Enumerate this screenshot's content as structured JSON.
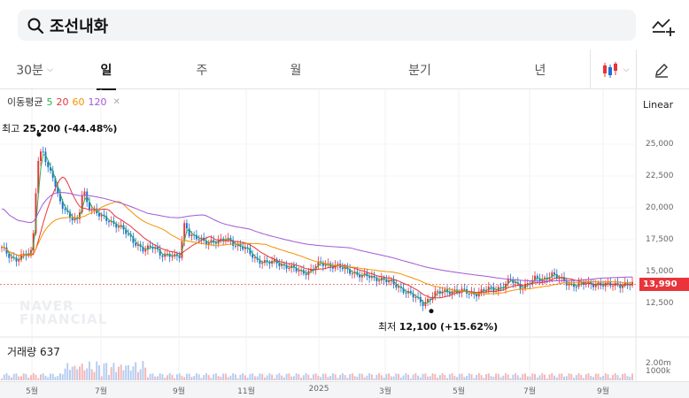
{
  "search": {
    "value": "조선내화"
  },
  "tabs": [
    {
      "label": "30분",
      "has_caret": true
    },
    {
      "label": "일",
      "active": true
    },
    {
      "label": "주"
    },
    {
      "label": "월"
    },
    {
      "label": "분기"
    },
    {
      "label": "년"
    }
  ],
  "legend": {
    "label": "이동평균",
    "items": [
      {
        "label": "5",
        "color": "#2bb14a"
      },
      {
        "label": "20",
        "color": "#e8343a"
      },
      {
        "label": "60",
        "color": "#f39200"
      },
      {
        "label": "120",
        "color": "#a258d6"
      }
    ]
  },
  "scale": "Linear",
  "annotations": {
    "high_prefix": "최고",
    "high_value": "25,200 (-44.48%)",
    "low_prefix": "최저",
    "low_value": "12,100 (+15.62%)"
  },
  "current_price": "13,990",
  "volume": {
    "label": "거래량",
    "value": "637",
    "ticks": [
      "2.00m",
      "1000k"
    ]
  },
  "watermark": [
    "NAVER",
    "FINANCIAL"
  ],
  "chart_data": {
    "type": "candlestick",
    "y_ticks": [
      "25,000",
      "22,500",
      "20,000",
      "17,500",
      "15,000",
      "12,500"
    ],
    "ylim": [
      11000,
      26500
    ],
    "x_ticks": [
      "5월",
      "7월",
      "9월",
      "11월",
      "2025",
      "3월",
      "5월",
      "7월",
      "9월"
    ],
    "close": [
      16800,
      16400,
      16100,
      16000,
      16200,
      16300,
      16500,
      23500,
      24800,
      23000,
      22500,
      21000,
      20200,
      19500,
      19000,
      18900,
      21600,
      20200,
      19800,
      19400,
      19200,
      19100,
      18800,
      18500,
      18200,
      17800,
      17400,
      17000,
      16600,
      16800,
      17000,
      16500,
      16300,
      16200,
      16100,
      16300,
      19000,
      17800,
      17600,
      17500,
      17400,
      17400,
      17300,
      17300,
      17600,
      17500,
      17100,
      16900,
      16700,
      16400,
      16000,
      15800,
      15600,
      15700,
      15800,
      15600,
      15400,
      15200,
      15100,
      15000,
      15000,
      15100,
      15500,
      15600,
      15600,
      15500,
      15400,
      15200,
      15100,
      15000,
      14800,
      14600,
      14600,
      14500,
      14500,
      14400,
      14200,
      14000,
      13800,
      13600,
      13300,
      13000,
      12700,
      12500,
      12900,
      13200,
      13300,
      13400,
      13500,
      13500,
      13400,
      13400,
      13300,
      13300,
      13400,
      13500,
      13600,
      13600,
      13800,
      14000,
      14300,
      14000,
      13800,
      14000,
      14200,
      14400,
      14300,
      14500,
      14900,
      14600,
      14300,
      14100,
      14000,
      14000,
      14000,
      14000,
      14000,
      14100,
      14000,
      13900,
      13900,
      14000,
      14000,
      14000,
      13990
    ],
    "moving_averages": {
      "ma5_color": "#2bb14a",
      "ma20_color": "#e8343a",
      "ma60_color": "#f39200",
      "ma120_color": "#a258d6"
    },
    "up_color": "#e8343a",
    "down_color": "#1b6fd6"
  }
}
